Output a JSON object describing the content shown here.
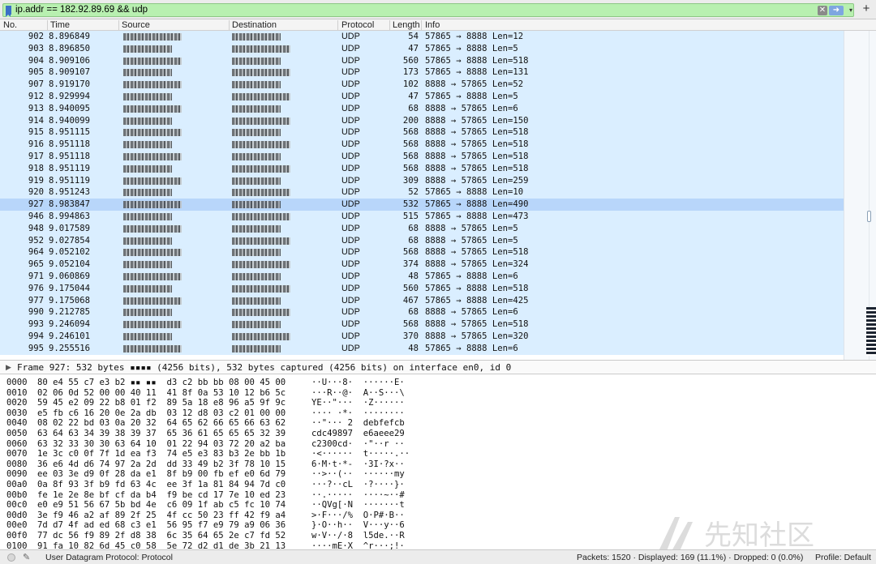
{
  "filter": {
    "value": "ip.addr == 182.92.89.69 && udp",
    "clear_glyph": "✕",
    "apply_glyph": "➜",
    "dropdown_glyph": "▾",
    "add_glyph": "+"
  },
  "packet_list": {
    "columns": {
      "no": "No.",
      "time": "Time",
      "source": "Source",
      "destination": "Destination",
      "protocol": "Protocol",
      "length": "Length",
      "info": "Info"
    },
    "rows": [
      {
        "no": "902",
        "time": "8.896849",
        "proto": "UDP",
        "len": "54",
        "info": "57865 → 8888 Len=12"
      },
      {
        "no": "903",
        "time": "8.896850",
        "proto": "UDP",
        "len": "47",
        "info": "57865 → 8888 Len=5"
      },
      {
        "no": "904",
        "time": "8.909106",
        "proto": "UDP",
        "len": "560",
        "info": "57865 → 8888 Len=518"
      },
      {
        "no": "905",
        "time": "8.909107",
        "proto": "UDP",
        "len": "173",
        "info": "57865 → 8888 Len=131"
      },
      {
        "no": "907",
        "time": "8.919170",
        "proto": "UDP",
        "len": "102",
        "info": "8888 → 57865 Len=52"
      },
      {
        "no": "912",
        "time": "8.929994",
        "proto": "UDP",
        "len": "47",
        "info": "57865 → 8888 Len=5"
      },
      {
        "no": "913",
        "time": "8.940095",
        "proto": "UDP",
        "len": "68",
        "info": "8888 → 57865 Len=6"
      },
      {
        "no": "914",
        "time": "8.940099",
        "proto": "UDP",
        "len": "200",
        "info": "8888 → 57865 Len=150"
      },
      {
        "no": "915",
        "time": "8.951115",
        "proto": "UDP",
        "len": "568",
        "info": "8888 → 57865 Len=518"
      },
      {
        "no": "916",
        "time": "8.951118",
        "proto": "UDP",
        "len": "568",
        "info": "8888 → 57865 Len=518"
      },
      {
        "no": "917",
        "time": "8.951118",
        "proto": "UDP",
        "len": "568",
        "info": "8888 → 57865 Len=518"
      },
      {
        "no": "918",
        "time": "8.951119",
        "proto": "UDP",
        "len": "568",
        "info": "8888 → 57865 Len=518"
      },
      {
        "no": "919",
        "time": "8.951119",
        "proto": "UDP",
        "len": "309",
        "info": "8888 → 57865 Len=259"
      },
      {
        "no": "920",
        "time": "8.951243",
        "proto": "UDP",
        "len": "52",
        "info": "57865 → 8888 Len=10"
      },
      {
        "no": "927",
        "time": "8.983847",
        "proto": "UDP",
        "len": "532",
        "info": "57865 → 8888 Len=490",
        "selected": true
      },
      {
        "no": "946",
        "time": "8.994863",
        "proto": "UDP",
        "len": "515",
        "info": "57865 → 8888 Len=473"
      },
      {
        "no": "948",
        "time": "9.017589",
        "proto": "UDP",
        "len": "68",
        "info": "8888 → 57865 Len=5"
      },
      {
        "no": "952",
        "time": "9.027854",
        "proto": "UDP",
        "len": "68",
        "info": "8888 → 57865 Len=5"
      },
      {
        "no": "964",
        "time": "9.052102",
        "proto": "UDP",
        "len": "568",
        "info": "8888 → 57865 Len=518"
      },
      {
        "no": "965",
        "time": "9.052104",
        "proto": "UDP",
        "len": "374",
        "info": "8888 → 57865 Len=324"
      },
      {
        "no": "971",
        "time": "9.060869",
        "proto": "UDP",
        "len": "48",
        "info": "57865 → 8888 Len=6"
      },
      {
        "no": "976",
        "time": "9.175044",
        "proto": "UDP",
        "len": "560",
        "info": "57865 → 8888 Len=518"
      },
      {
        "no": "977",
        "time": "9.175068",
        "proto": "UDP",
        "len": "467",
        "info": "57865 → 8888 Len=425"
      },
      {
        "no": "990",
        "time": "9.212785",
        "proto": "UDP",
        "len": "68",
        "info": "8888 → 57865 Len=6"
      },
      {
        "no": "993",
        "time": "9.246094",
        "proto": "UDP",
        "len": "568",
        "info": "8888 → 57865 Len=518"
      },
      {
        "no": "994",
        "time": "9.246101",
        "proto": "UDP",
        "len": "370",
        "info": "8888 → 57865 Len=320"
      },
      {
        "no": "995",
        "time": "9.255516",
        "proto": "UDP",
        "len": "48",
        "info": "57865 → 8888 Len=6"
      }
    ]
  },
  "detail": {
    "expand_glyph": "▶",
    "frame_summary": "Frame 927: 532 bytes ▪▪▪▪ (4256 bits), 532 bytes captured (4256 bits) on interface en0, id 0"
  },
  "hex_dump": [
    {
      "off": "0000",
      "hex": "80 e4 55 c7 e3 b2 ▪▪ ▪▪  d3 c2 bb bb 08 00 45 00",
      "ascii": "··U···8·  ······E·"
    },
    {
      "off": "0010",
      "hex": "02 06 0d 52 00 00 40 11  41 8f 0a 53 10 12 b6 5c",
      "ascii": "···R··@·  A··S···\\"
    },
    {
      "off": "0020",
      "hex": "59 45 e2 09 22 b8 01 f2  89 5a 18 e8 96 a5 9f 9c",
      "ascii": "YE··\"···  ·Z······"
    },
    {
      "off": "0030",
      "hex": "e5 fb c6 16 20 0e 2a db  03 12 d8 03 c2 01 00 00",
      "ascii": "···· ·*·  ········"
    },
    {
      "off": "0040",
      "hex": "08 02 22 bd 03 0a 20 32  64 65 62 66 65 66 63 62",
      "ascii": "··\"··· 2  debfefcb"
    },
    {
      "off": "0050",
      "hex": "63 64 63 34 39 38 39 37  65 36 61 65 65 65 32 39",
      "ascii": "cdc49897  e6aeee29"
    },
    {
      "off": "0060",
      "hex": "63 32 33 30 30 63 64 10  01 22 94 03 72 20 a2 ba",
      "ascii": "c2300cd·  ·\"··r ··"
    },
    {
      "off": "0070",
      "hex": "1e 3c c0 0f 7f 1d ea f3  74 e5 e3 83 b3 2e bb 1b",
      "ascii": "·<······  t·····.··"
    },
    {
      "off": "0080",
      "hex": "36 e6 4d d6 74 97 2a 2d  dd 33 49 b2 3f 78 10 15",
      "ascii": "6·M·t·*-  ·3I·?x··"
    },
    {
      "off": "0090",
      "hex": "ee 03 3e d9 0f 28 da e1  8f b9 00 fb ef e0 6d 79",
      "ascii": "··>··(··  ······my"
    },
    {
      "off": "00a0",
      "hex": "0a 8f 93 3f b9 fd 63 4c  ee 3f 1a 81 84 94 7d c0",
      "ascii": "···?··cL  ·?····}·"
    },
    {
      "off": "00b0",
      "hex": "fe 1e 2e 8e bf cf da b4  f9 be cd 17 7e 10 ed 23",
      "ascii": "··.·····  ····~··#"
    },
    {
      "off": "00c0",
      "hex": "e0 e9 51 56 67 5b bd 4e  c6 09 1f ab c5 fc 10 74",
      "ascii": "··QVg[·N  ·······t"
    },
    {
      "off": "00d0",
      "hex": "3e f9 46 a2 af 89 2f 25  4f cc 50 23 ff 42 f9 a4",
      "ascii": ">·F···/%  O·P#·B··"
    },
    {
      "off": "00e0",
      "hex": "7d d7 4f ad ed 68 c3 e1  56 95 f7 e9 79 a9 06 36",
      "ascii": "}·O··h··  V···y··6"
    },
    {
      "off": "00f0",
      "hex": "77 dc 56 f9 89 2f d8 38  6c 35 64 65 2e c7 fd 52",
      "ascii": "w·V··/·8  l5de.··R"
    },
    {
      "off": "0100",
      "hex": "91 fa 10 82 6d 45 c0 58  5e 72 d2 d1 de 3b 21 13",
      "ascii": "····mE·X  ^r···;!·"
    }
  ],
  "status": {
    "protocol_label": "User Datagram Protocol: Protocol",
    "packet_stats": "Packets: 1520 · Displayed: 169 (11.1%) · Dropped: 0 (0.0%)",
    "profile": "Profile: Default",
    "edit_glyph": "✎"
  },
  "watermark": {
    "text": "先知社区"
  },
  "colors": {
    "row_bg": "#daeeff",
    "row_selected": "#b8d6fa",
    "filter_ok": "#b8f0b0"
  }
}
